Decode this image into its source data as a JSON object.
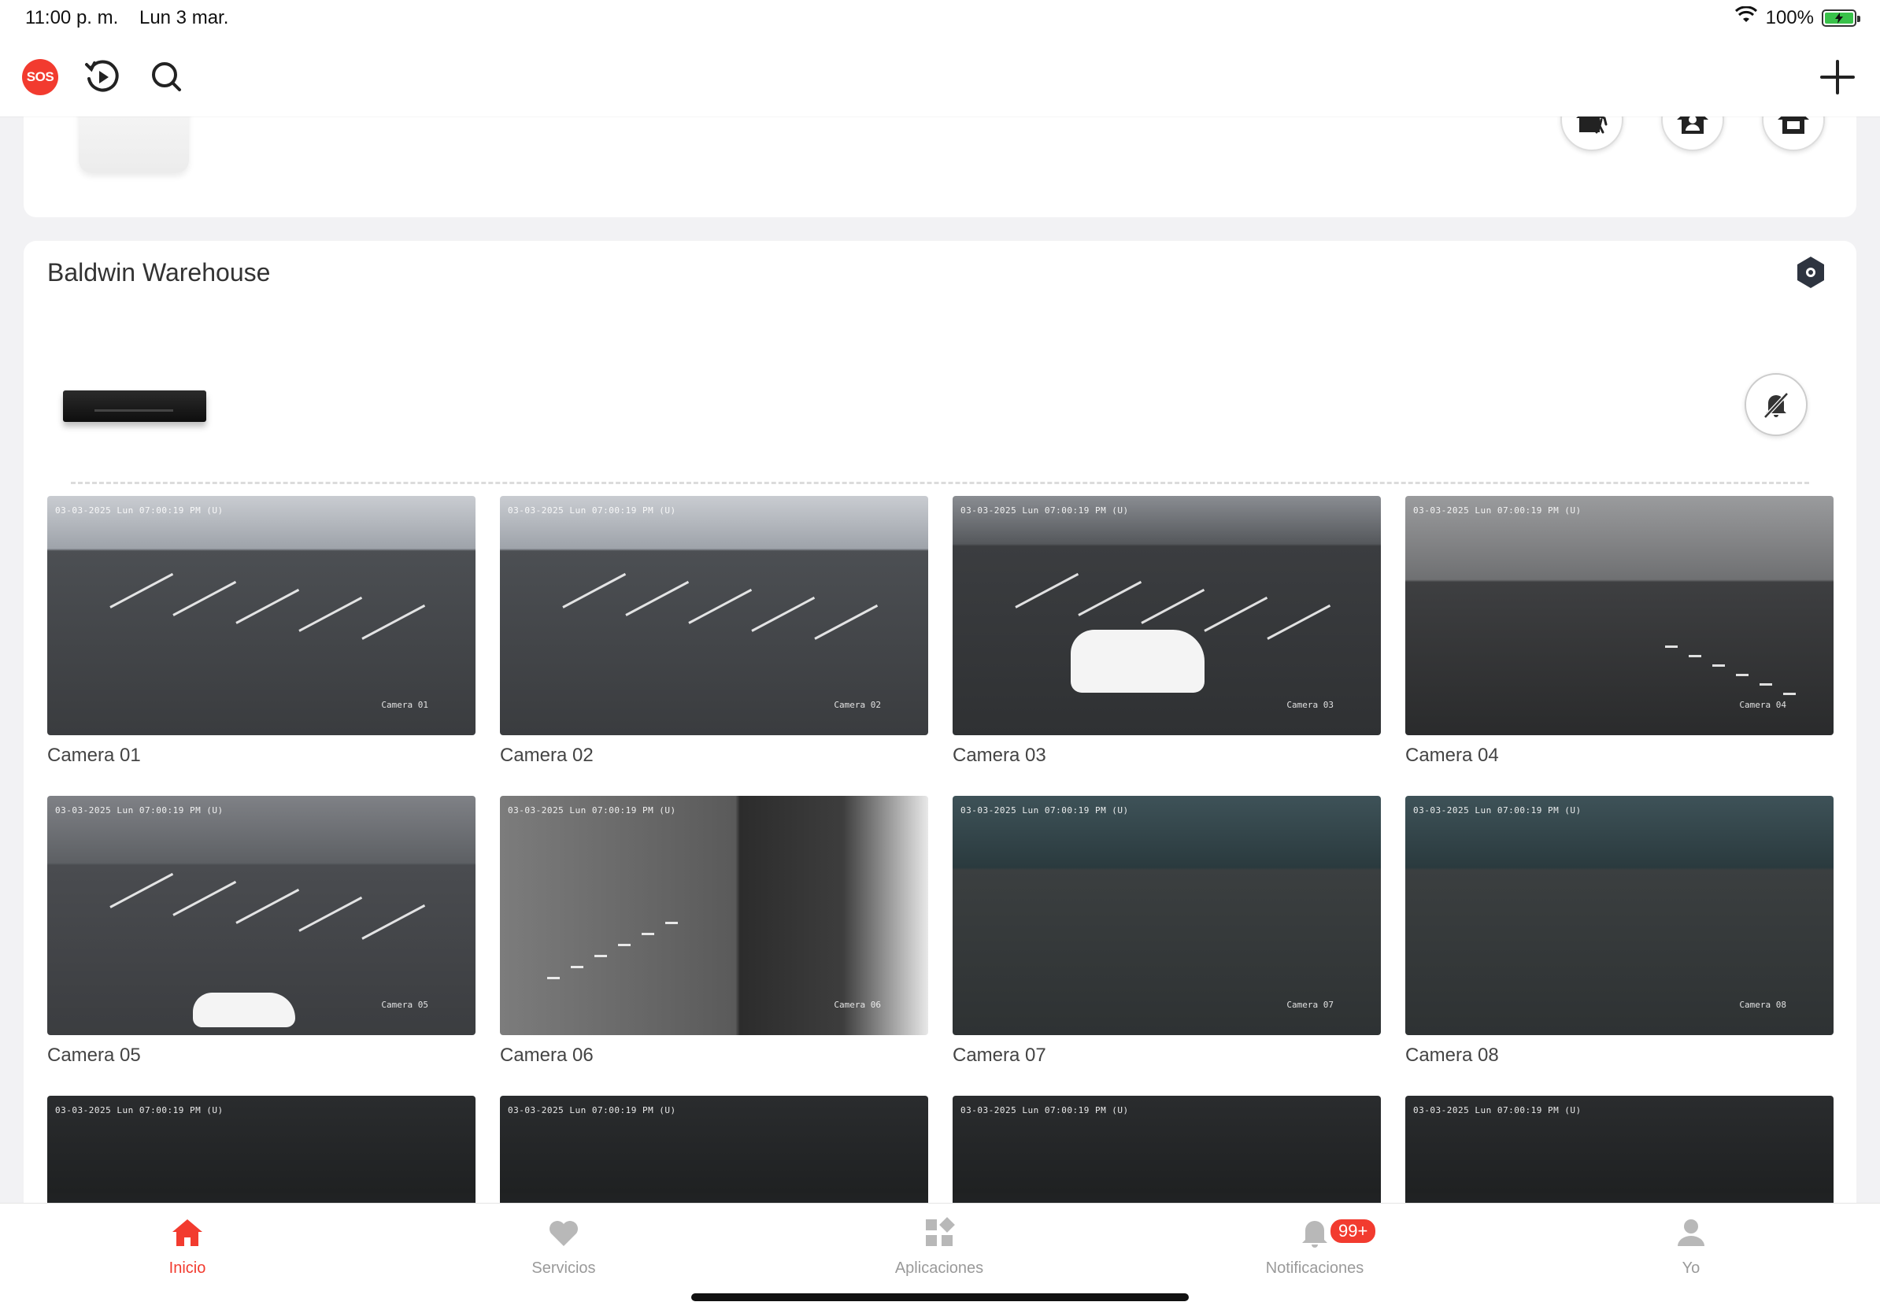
{
  "status_bar": {
    "time": "11:00 p. m.",
    "date": "Lun 3 mar.",
    "battery": "100%"
  },
  "top_nav": {
    "sos_label": "SOS",
    "icons": [
      "playback-icon",
      "search-icon",
      "plus-icon"
    ]
  },
  "modes": [
    "away-mode-icon",
    "stay-mode-icon",
    "home-mode-icon"
  ],
  "site": {
    "title": "Baldwin Warehouse"
  },
  "cameras": [
    {
      "name": "Camera 01",
      "stamp": "03-03-2025 Lun 07:00:19 PM (U)",
      "osd": "Camera 01",
      "scene": "lot"
    },
    {
      "name": "Camera 02",
      "stamp": "03-03-2025 Lun 07:00:19 PM (U)",
      "osd": "Camera 02",
      "scene": "lot"
    },
    {
      "name": "Camera 03",
      "stamp": "03-03-2025 Lun 07:00:19 PM (U)",
      "osd": "Camera 03",
      "scene": "car"
    },
    {
      "name": "Camera 04",
      "stamp": "03-03-2025 Lun 07:00:19 PM (U)",
      "osd": "Camera 04",
      "scene": "dock"
    },
    {
      "name": "Camera 05",
      "stamp": "03-03-2025 Lun 07:00:19 PM (U)",
      "osd": "Camera 05",
      "scene": "trucks"
    },
    {
      "name": "Camera 06",
      "stamp": "03-03-2025 Lun 07:00:19 PM (U)",
      "osd": "Camera 06",
      "scene": "trailer"
    },
    {
      "name": "Camera 07",
      "stamp": "03-03-2025 Lun 07:00:19 PM (U)",
      "osd": "Camera 07",
      "scene": "interior"
    },
    {
      "name": "Camera 08",
      "stamp": "03-03-2025 Lun 07:00:19 PM (U)",
      "osd": "Camera 08",
      "scene": "interior"
    },
    {
      "name": "",
      "stamp": "03-03-2025 Lun 07:00:19 PM (U)",
      "osd": "",
      "scene": "dark"
    },
    {
      "name": "",
      "stamp": "03-03-2025 Lun 07:00:19 PM (U)",
      "osd": "",
      "scene": "dark"
    },
    {
      "name": "",
      "stamp": "03-03-2025 Lun 07:00:19 PM (U)",
      "osd": "",
      "scene": "dark"
    },
    {
      "name": "",
      "stamp": "03-03-2025 Lun 07:00:19 PM (U)",
      "osd": "",
      "scene": "dark"
    }
  ],
  "tabs": [
    {
      "label": "Inicio",
      "icon": "home-icon",
      "active": true
    },
    {
      "label": "Servicios",
      "icon": "heart-icon",
      "active": false
    },
    {
      "label": "Aplicaciones",
      "icon": "apps-icon",
      "active": false
    },
    {
      "label": "Notificaciones",
      "icon": "bell-icon",
      "active": false,
      "badge": "99+"
    },
    {
      "label": "Yo",
      "icon": "person-icon",
      "active": false
    }
  ],
  "colors": {
    "accent": "#f23b2f",
    "inactive": "#9a9a9a",
    "background": "#f2f2f4"
  }
}
